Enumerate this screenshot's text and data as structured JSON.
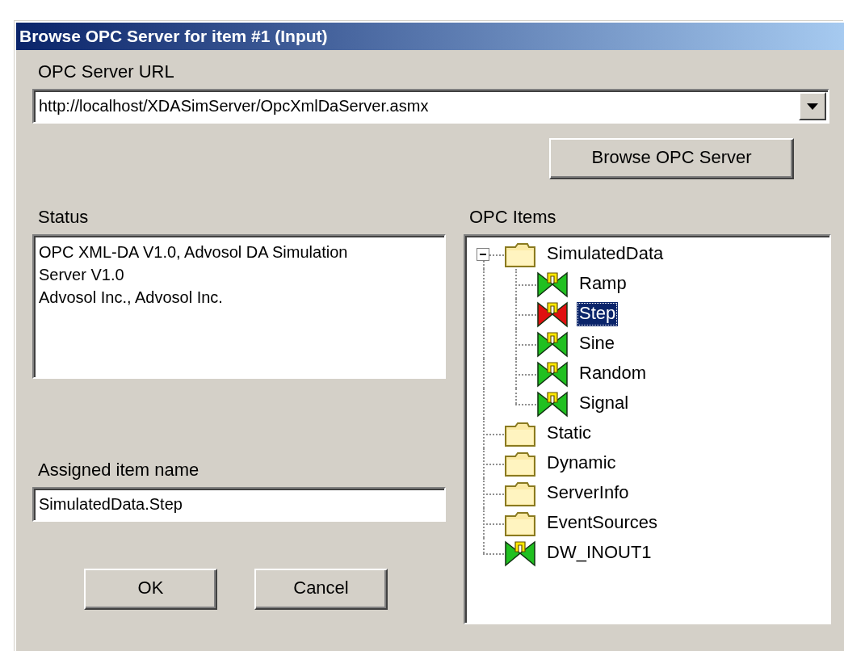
{
  "window": {
    "title": "Browse OPC Server for item #1 (Input)"
  },
  "url": {
    "label": "OPC Server URL",
    "value": "http://localhost/XDASimServer/OpcXmlDaServer.asmx"
  },
  "browse_button": "Browse OPC Server",
  "status": {
    "label": "Status",
    "lines": [
      "OPC XML-DA V1.0, Advosol DA Simulation",
      "Server V1.0",
      "Advosol Inc., Advosol Inc."
    ]
  },
  "assigned": {
    "label": "Assigned item name",
    "value": "SimulatedData.Step"
  },
  "buttons": [
    "OK",
    "Cancel"
  ],
  "items": {
    "label": "OPC Items",
    "tree": [
      {
        "kind": "folder",
        "label": "SimulatedData",
        "selected": false,
        "expanded": true,
        "children": [
          {
            "kind": "tag",
            "label": "Ramp",
            "selected": false,
            "color": "#20c020"
          },
          {
            "kind": "tag",
            "label": "Step",
            "selected": true,
            "color": "#e01010"
          },
          {
            "kind": "tag",
            "label": "Sine",
            "selected": false,
            "color": "#20c020"
          },
          {
            "kind": "tag",
            "label": "Random",
            "selected": false,
            "color": "#20c020"
          },
          {
            "kind": "tag",
            "label": "Signal",
            "selected": false,
            "color": "#20c020"
          }
        ]
      },
      {
        "kind": "folder",
        "label": "Static",
        "selected": false
      },
      {
        "kind": "folder",
        "label": "Dynamic",
        "selected": false
      },
      {
        "kind": "folder",
        "label": "ServerInfo",
        "selected": false
      },
      {
        "kind": "folder",
        "label": "EventSources",
        "selected": false
      },
      {
        "kind": "tag",
        "label": "DW_INOUT1",
        "selected": false,
        "color": "#20c020"
      }
    ]
  }
}
